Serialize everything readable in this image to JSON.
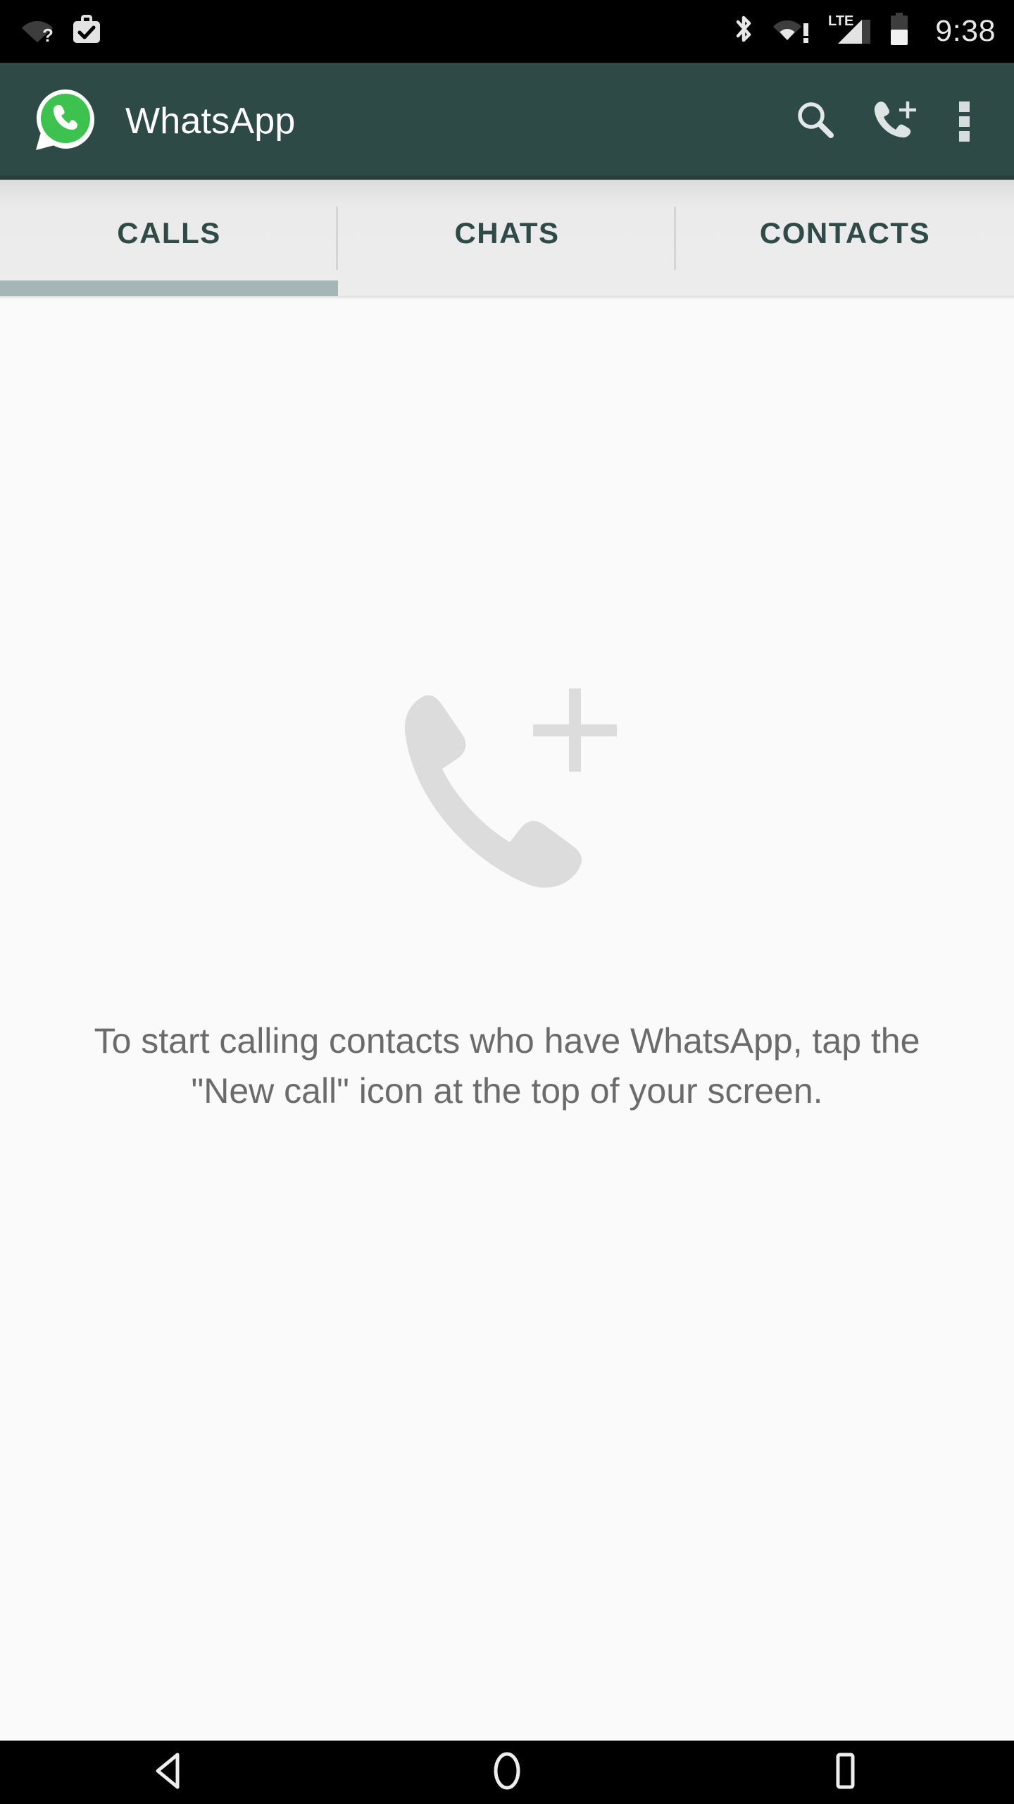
{
  "status_bar": {
    "time": "9:38",
    "left_icons": [
      {
        "name": "wifi-no-internet-icon",
        "label": "WiFi (no internet)"
      },
      {
        "name": "work-profile-icon",
        "label": "Work profile"
      }
    ],
    "right_icons": [
      {
        "name": "bluetooth-icon",
        "label": "Bluetooth"
      },
      {
        "name": "wifi-warning-icon",
        "label": "WiFi warning"
      },
      {
        "name": "lte-signal-icon",
        "label": "LTE"
      },
      {
        "name": "battery-icon",
        "label": "Battery"
      }
    ],
    "network_type": "LTE",
    "background_color": "#000000",
    "text_color": "#e8e8e8"
  },
  "app_bar": {
    "title": "WhatsApp",
    "logo_icon": "whatsapp-logo-icon",
    "background_color": "#2e4a47",
    "title_color": "#ffffff",
    "actions": [
      {
        "name": "search-icon",
        "label": "Search"
      },
      {
        "name": "new-call-icon",
        "label": "New call"
      },
      {
        "name": "overflow-menu-icon",
        "label": "More options"
      }
    ]
  },
  "tabs": {
    "active_index": 0,
    "indicator_color": "#a4b6b5",
    "label_color": "#2f4a47",
    "items": [
      {
        "label": "CALLS"
      },
      {
        "label": "CHATS"
      },
      {
        "label": "CONTACTS"
      }
    ]
  },
  "content": {
    "illustration_icon": "phone-plus-illustration-icon",
    "illustration_color": "#dcdcdc",
    "empty_message": "To start calling contacts who have WhatsApp, tap the \"New call\" icon at the top of your screen.",
    "background_color": "#fafafa",
    "text_color": "#6b6b6b"
  },
  "nav_bar": {
    "background_color": "#000000",
    "buttons": [
      {
        "name": "back-button",
        "label": "Back"
      },
      {
        "name": "home-button",
        "label": "Home"
      },
      {
        "name": "recents-button",
        "label": "Recent apps"
      }
    ]
  }
}
